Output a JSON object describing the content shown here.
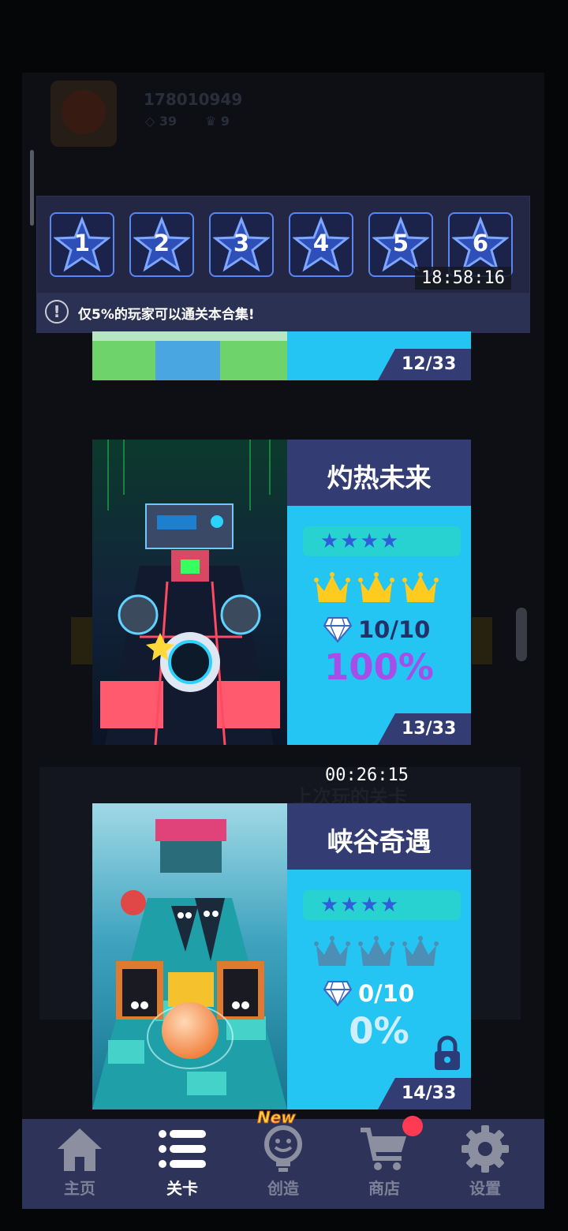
{
  "background_app": {
    "user_id": "178010949",
    "gem_count": "39",
    "crown_count": "9",
    "last_played_label": "上次玩的关卡"
  },
  "collection": {
    "levels": [
      "1",
      "2",
      "3",
      "4",
      "5",
      "6"
    ],
    "notice": "仅5%的玩家可以通关本合集!"
  },
  "overlay_times": {
    "top": "18:58:16",
    "middle": "00:26:15"
  },
  "levels": [
    {
      "progress": "12/33"
    },
    {
      "title": "灼热未来",
      "stars": "★★★★",
      "crowns_earned": 3,
      "gems": "10/10",
      "percent": "100%",
      "progress": "13/33",
      "locked": false
    },
    {
      "title": "峡谷奇遇",
      "stars": "★★★★",
      "crowns_earned": 0,
      "gems": "0/10",
      "percent": "0%",
      "progress": "14/33",
      "locked": true
    }
  ],
  "colors": {
    "panel_blue": "#24c4f3",
    "title_bar": "#333c73",
    "crown_gold": "#ffcb1f",
    "crown_empty": "#4d8fb4",
    "percent_full": "#a64ee8",
    "percent_empty": "#cfefff"
  },
  "nav": {
    "new_badge": "New",
    "items": [
      {
        "label": "主页",
        "icon": "home-icon"
      },
      {
        "label": "关卡",
        "icon": "list-icon",
        "active": true
      },
      {
        "label": "创造",
        "icon": "lightbulb-icon"
      },
      {
        "label": "商店",
        "icon": "cart-icon"
      },
      {
        "label": "设置",
        "icon": "gear-icon"
      }
    ]
  }
}
